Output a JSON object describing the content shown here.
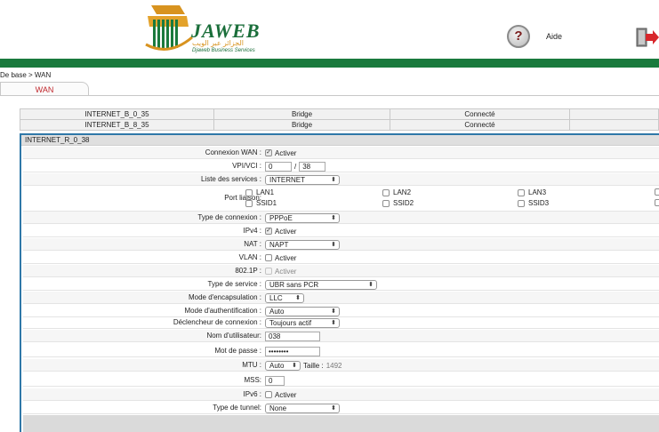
{
  "header": {
    "logo_text": "JAWEB",
    "logo_arabic": "الجزائر عبر الويب",
    "logo_subtitle": "Djaweb Business Services",
    "help_label": "Aide"
  },
  "breadcrumb": "De base > WAN",
  "tab_label": "WAN",
  "connections": [
    {
      "name": "INTERNET_B_0_35",
      "mode": "Bridge",
      "status": "Connecté"
    },
    {
      "name": "INTERNET_B_8_35",
      "mode": "Bridge",
      "status": "Connecté"
    }
  ],
  "panel_title": "INTERNET_R_0_38",
  "form": {
    "wan_connection": {
      "label": "Connexion WAN :",
      "option": "Activer"
    },
    "vpi_vci": {
      "label": "VPI/VCI :",
      "vpi": "0",
      "separator": "/",
      "vci": "38"
    },
    "services": {
      "label": "Liste des services :",
      "value": "INTERNET"
    },
    "port_binding": {
      "label": "Port liaison:",
      "lan": [
        "LAN1",
        "LAN2",
        "LAN3"
      ],
      "ssid": [
        "SSID1",
        "SSID2",
        "SSID3"
      ]
    },
    "connection_type": {
      "label": "Type de connexion :",
      "value": "PPPoE"
    },
    "ipv4": {
      "label": "IPv4 :",
      "option": "Activer"
    },
    "nat": {
      "label": "NAT :",
      "value": "NAPT"
    },
    "vlan": {
      "label": "VLAN :",
      "option": "Activer"
    },
    "dot1p": {
      "label": "802.1P :",
      "option": "Activer"
    },
    "service_type": {
      "label": "Type de service :",
      "value": "UBR sans PCR"
    },
    "encapsulation": {
      "label": "Mode d'encapsulation :",
      "value": "LLC"
    },
    "auth_mode": {
      "label": "Mode d'authentification :",
      "value": "Auto"
    },
    "trigger": {
      "label": "Déclencheur de connexion :",
      "value": "Toujours actif"
    },
    "username": {
      "label": "Nom d'utilisateur:",
      "value": "038"
    },
    "password": {
      "label": "Mot de passe :",
      "value": "••••••••"
    },
    "mtu": {
      "label": "MTU :",
      "value": "Auto",
      "size_label": "Taille :",
      "size_value": "1492"
    },
    "mss": {
      "label": "MSS:",
      "value": "0"
    },
    "ipv6": {
      "label": "IPv6 :",
      "option": "Activer"
    },
    "tunnel": {
      "label": "Type de tunnel:",
      "value": "None"
    }
  }
}
